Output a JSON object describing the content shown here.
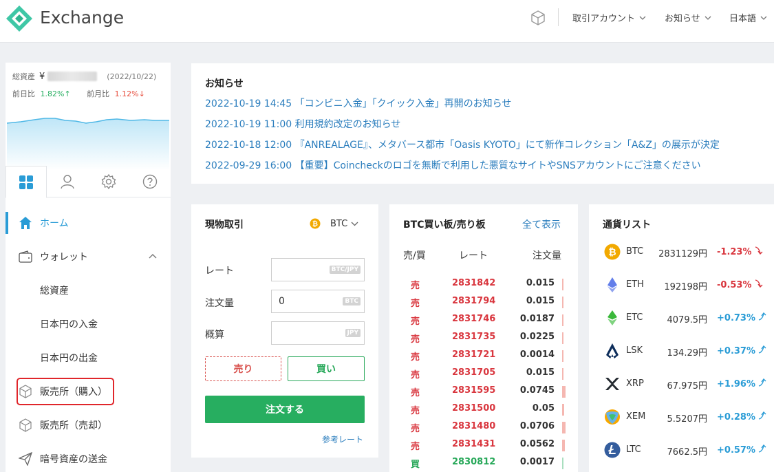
{
  "header": {
    "brand": "Exchange",
    "menus": [
      {
        "label": "取引アカウント"
      },
      {
        "label": "お知らせ"
      },
      {
        "label": "日本語"
      }
    ]
  },
  "sidebar": {
    "total_assets_label": "総資産",
    "currency_symbol": "¥",
    "assets_date": "(2022/10/22)",
    "day_ratio_label": "前日比",
    "day_ratio_value": "1.82%↑",
    "month_ratio_label": "前月比",
    "month_ratio_value": "1.12%↓",
    "nav": [
      {
        "label": "ホーム"
      },
      {
        "label": "ウォレット"
      },
      {
        "label": "総資産"
      },
      {
        "label": "日本円の入金"
      },
      {
        "label": "日本円の出金"
      },
      {
        "label": "販売所（購入）"
      },
      {
        "label": "販売所（売却）"
      },
      {
        "label": "暗号資産の送金"
      }
    ]
  },
  "notice": {
    "title": "お知らせ",
    "items": [
      "2022-10-19 14:45 「コンビニ入金」「クイック入金」再開のお知らせ",
      "2022-10-19 11:00 利用規約改定のお知らせ",
      "2022-10-18 12:00 『ANREALAGE』、メタバース都市「Oasis KYOTO」にて新作コレクション「A&Z」の展示が決定",
      "2022-09-29 16:00 【重要】Coincheckのロゴを無断で利用した悪質なサイトやSNSアカウントにご注意ください"
    ]
  },
  "trade": {
    "title": "現物取引",
    "coin": "BTC",
    "rate_label": "レート",
    "rate_unit": "BTC/JPY",
    "amount_label": "注文量",
    "amount_value": "0",
    "amount_unit": "BTC",
    "estimate_label": "概算",
    "estimate_unit": "JPY",
    "sell_label": "売り",
    "buy_label": "買い",
    "order_label": "注文する",
    "ref_rate_label": "参考レート"
  },
  "orderbook": {
    "title": "BTC買い板/売り板",
    "show_all": "全て表示",
    "col_side": "売/買",
    "col_rate": "レート",
    "col_amount": "注文量",
    "rows": [
      {
        "side": "売",
        "rate": "2831842",
        "amount": "0.015",
        "kind": "sell",
        "depth": 0.015
      },
      {
        "side": "売",
        "rate": "2831794",
        "amount": "0.015",
        "kind": "sell",
        "depth": 0.015
      },
      {
        "side": "売",
        "rate": "2831746",
        "amount": "0.0187",
        "kind": "sell",
        "depth": 0.0187
      },
      {
        "side": "売",
        "rate": "2831735",
        "amount": "0.0225",
        "kind": "sell",
        "depth": 0.0225
      },
      {
        "side": "売",
        "rate": "2831721",
        "amount": "0.0014",
        "kind": "sell",
        "depth": 0.0014
      },
      {
        "side": "売",
        "rate": "2831705",
        "amount": "0.015",
        "kind": "sell",
        "depth": 0.015
      },
      {
        "side": "売",
        "rate": "2831595",
        "amount": "0.0745",
        "kind": "sell",
        "depth": 0.0745
      },
      {
        "side": "売",
        "rate": "2831500",
        "amount": "0.05",
        "kind": "sell",
        "depth": 0.05
      },
      {
        "side": "売",
        "rate": "2831480",
        "amount": "0.0706",
        "kind": "sell",
        "depth": 0.0706
      },
      {
        "side": "売",
        "rate": "2831431",
        "amount": "0.0562",
        "kind": "sell",
        "depth": 0.0562
      },
      {
        "side": "買",
        "rate": "2830812",
        "amount": "0.0017",
        "kind": "buy",
        "depth": 0.0017
      }
    ]
  },
  "coinlist": {
    "title": "通貨リスト",
    "items": [
      {
        "symbol": "BTC",
        "price": "2831129円",
        "change": "-1.23%",
        "dir": "down",
        "icon": "bitcoin-icon",
        "color": "#f2a900"
      },
      {
        "symbol": "ETH",
        "price": "192198円",
        "change": "-0.53%",
        "dir": "down",
        "icon": "ethereum-icon",
        "color": "#627eea"
      },
      {
        "symbol": "ETC",
        "price": "4079.5円",
        "change": "+0.73%",
        "dir": "up",
        "icon": "ethereum-classic-icon",
        "color": "#3ab83a"
      },
      {
        "symbol": "LSK",
        "price": "134.29円",
        "change": "+0.37%",
        "dir": "up",
        "icon": "lisk-icon",
        "color": "#0d2d5a"
      },
      {
        "symbol": "XRP",
        "price": "67.975円",
        "change": "+1.96%",
        "dir": "up",
        "icon": "xrp-icon",
        "color": "#23292f"
      },
      {
        "symbol": "XEM",
        "price": "5.5207円",
        "change": "+0.28%",
        "dir": "up",
        "icon": "nem-icon",
        "color": "#67b2e8"
      },
      {
        "symbol": "LTC",
        "price": "7662.5円",
        "change": "+0.57%",
        "dir": "up",
        "icon": "litecoin-icon",
        "color": "#345d9d"
      }
    ]
  },
  "colors": {
    "accent": "#2a9cd6",
    "buy": "#27ae60",
    "sell": "#d9363e",
    "highlight": "#e0262b"
  }
}
